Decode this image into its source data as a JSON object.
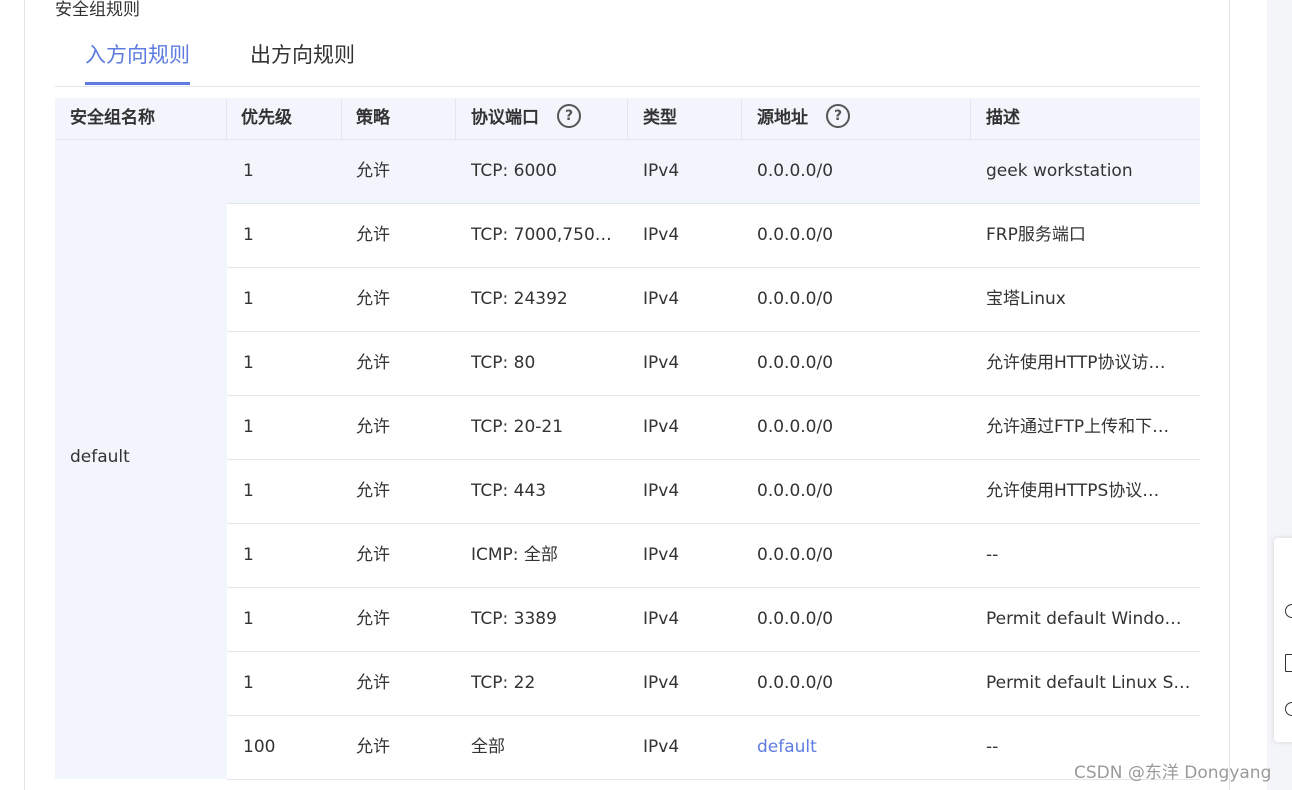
{
  "section": {
    "title": "安全组规则"
  },
  "tabs": [
    {
      "label": "入方向规则",
      "active": true
    },
    {
      "label": "出方向规则",
      "active": false
    }
  ],
  "table": {
    "columns": [
      "安全组名称",
      "优先级",
      "策略",
      "协议端口",
      "类型",
      "源地址",
      "描述"
    ],
    "group_name": "default",
    "rows": [
      {
        "priority": "1",
        "policy": "允许",
        "protocol_port": "TCP: 6000",
        "type": "IPv4",
        "source": "0.0.0.0/0",
        "description": "geek workstation"
      },
      {
        "priority": "1",
        "policy": "允许",
        "protocol_port": "TCP: 7000,750…",
        "type": "IPv4",
        "source": "0.0.0.0/0",
        "description": "FRP服务端口"
      },
      {
        "priority": "1",
        "policy": "允许",
        "protocol_port": "TCP: 24392",
        "type": "IPv4",
        "source": "0.0.0.0/0",
        "description": "宝塔Linux"
      },
      {
        "priority": "1",
        "policy": "允许",
        "protocol_port": "TCP: 80",
        "type": "IPv4",
        "source": "0.0.0.0/0",
        "description": "允许使用HTTP协议访…"
      },
      {
        "priority": "1",
        "policy": "允许",
        "protocol_port": "TCP: 20-21",
        "type": "IPv4",
        "source": "0.0.0.0/0",
        "description": "允许通过FTP上传和下…"
      },
      {
        "priority": "1",
        "policy": "允许",
        "protocol_port": "TCP: 443",
        "type": "IPv4",
        "source": "0.0.0.0/0",
        "description": "允许使用HTTPS协议…"
      },
      {
        "priority": "1",
        "policy": "允许",
        "protocol_port": "ICMP: 全部",
        "type": "IPv4",
        "source": "0.0.0.0/0",
        "description": "--"
      },
      {
        "priority": "1",
        "policy": "允许",
        "protocol_port": "TCP: 3389",
        "type": "IPv4",
        "source": "0.0.0.0/0",
        "description": "Permit default Window…"
      },
      {
        "priority": "1",
        "policy": "允许",
        "protocol_port": "TCP: 22",
        "type": "IPv4",
        "source": "0.0.0.0/0",
        "description": "Permit default Linux S…"
      },
      {
        "priority": "100",
        "policy": "允许",
        "protocol_port": "全部",
        "type": "IPv4",
        "source": "default",
        "description": "--"
      }
    ]
  },
  "watermark": "CSDN @东洋 Dongyang",
  "colors": {
    "accent": "#5e7ce0",
    "header_bg": "#f2f5fc",
    "border": "#e3e6ee"
  }
}
